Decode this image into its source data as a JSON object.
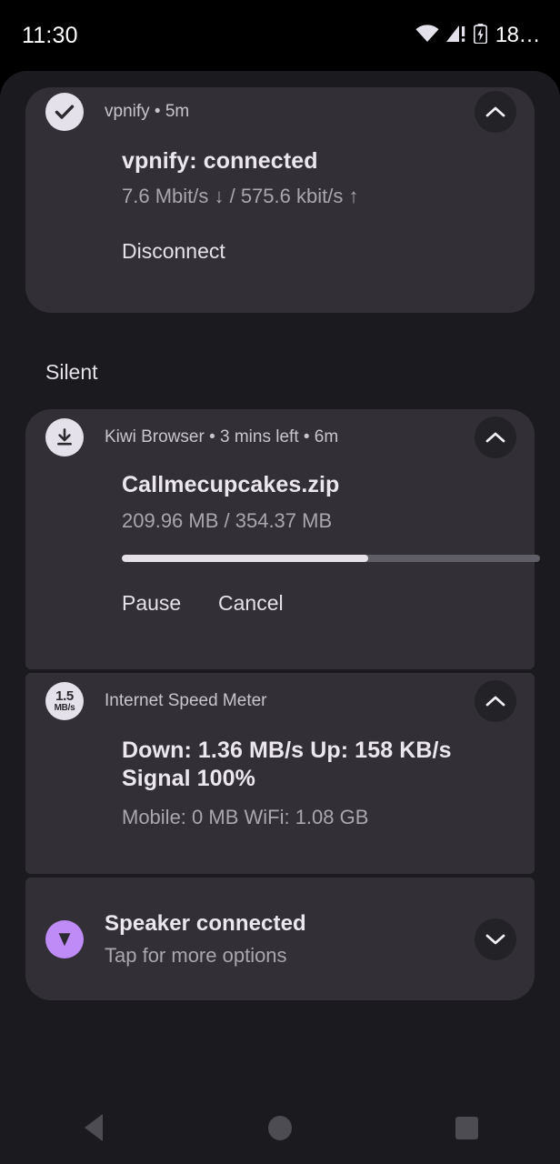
{
  "status_bar": {
    "clock": "11:30",
    "battery_text": "18…",
    "icons": [
      "wifi-icon",
      "cellular-signal-alert-icon",
      "battery-charging-icon"
    ]
  },
  "shade": {
    "silent_section_label": "Silent"
  },
  "notifications": [
    {
      "id": "vpnify",
      "app_icon": "checkmark-icon",
      "header": "vpnify  •  5m",
      "app_name": "vpnify",
      "time": "5m",
      "title": "vpnify: connected",
      "body": "7.6 Mbit/s ↓ / 575.6 kbit/s ↑",
      "actions": [
        "Disconnect"
      ],
      "expand_state": "expanded",
      "chevron": "chevron-up-icon"
    },
    {
      "id": "kiwi-browser",
      "app_icon": "download-icon",
      "header": "Kiwi Browser  •  3 mins left  •  6m",
      "app_name": "Kiwi Browser",
      "time_remaining": "3 mins left",
      "time": "6m",
      "title": "Callmecupcakes.zip",
      "body": "209.96 MB / 354.37 MB",
      "progress_percent": 59,
      "downloaded": "209.96 MB",
      "total": "354.37 MB",
      "actions": [
        "Pause",
        "Cancel"
      ],
      "expand_state": "expanded",
      "chevron": "chevron-up-icon"
    },
    {
      "id": "internet-speed-meter",
      "app_icon": "speed-badge-icon",
      "app_icon_value": "1.5",
      "app_icon_unit": "MB/s",
      "header": "Internet Speed Meter",
      "app_name": "Internet Speed Meter",
      "title": "Down: 1.36 MB/s   Up: 158 KB/s     Signal 100%",
      "body": "Mobile: 0 MB   WiFi: 1.08 GB",
      "expand_state": "expanded",
      "chevron": "chevron-up-icon"
    },
    {
      "id": "speaker-connected",
      "app_icon": "cast-speaker-icon",
      "title": "Speaker connected",
      "body": "Tap for more options",
      "expand_state": "collapsed",
      "chevron": "chevron-down-icon"
    }
  ],
  "nav_bar": {
    "back_label": "Back",
    "home_label": "Home",
    "recents_label": "Recents"
  },
  "colors": {
    "screen_background": "#000000",
    "shade_background": "#1b1b1f",
    "card_background": "#323036",
    "title_text": "#ece7ef",
    "body_text": "#a9a6ae",
    "header_text": "#c8c5cd",
    "accent_lavender": "#e5e1ea",
    "accent_purple": "#bf8bf7",
    "progress_track": "#5f5e66",
    "nav_icon": "#4c4c52"
  }
}
